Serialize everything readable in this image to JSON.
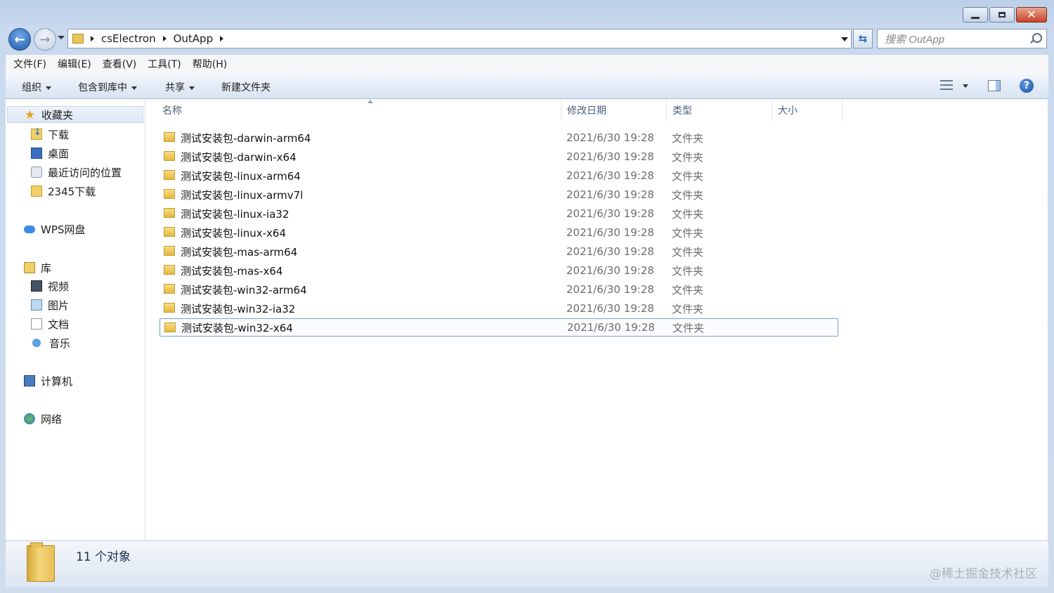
{
  "window": {
    "controls": {
      "minimize": "minimize-icon",
      "maximize": "maximize-icon",
      "close": "close-icon"
    }
  },
  "nav": {
    "breadcrumb": [
      "csElectron",
      "OutApp"
    ],
    "search_placeholder": "搜索 OutApp"
  },
  "menubar": [
    "文件(F)",
    "编辑(E)",
    "查看(V)",
    "工具(T)",
    "帮助(H)"
  ],
  "commands": {
    "organize": "组织",
    "include_library": "包含到库中",
    "share": "共享",
    "new_folder": "新建文件夹"
  },
  "sidebar": {
    "favorites": "收藏夹",
    "fav_items": [
      "下载",
      "桌面",
      "最近访问的位置",
      "2345下载"
    ],
    "wps": "WPS网盘",
    "library": "库",
    "lib_items": [
      "视频",
      "图片",
      "文档",
      "音乐"
    ],
    "computer": "计算机",
    "network": "网络"
  },
  "columns": {
    "name": "名称",
    "modified": "修改日期",
    "type": "类型",
    "size": "大小"
  },
  "files": [
    {
      "name": "测试安装包-darwin-arm64",
      "modified": "2021/6/30 19:28",
      "type": "文件夹"
    },
    {
      "name": "测试安装包-darwin-x64",
      "modified": "2021/6/30 19:28",
      "type": "文件夹"
    },
    {
      "name": "测试安装包-linux-arm64",
      "modified": "2021/6/30 19:28",
      "type": "文件夹"
    },
    {
      "name": "测试安装包-linux-armv7l",
      "modified": "2021/6/30 19:28",
      "type": "文件夹"
    },
    {
      "name": "测试安装包-linux-ia32",
      "modified": "2021/6/30 19:28",
      "type": "文件夹"
    },
    {
      "name": "测试安装包-linux-x64",
      "modified": "2021/6/30 19:28",
      "type": "文件夹"
    },
    {
      "name": "测试安装包-mas-arm64",
      "modified": "2021/6/30 19:28",
      "type": "文件夹"
    },
    {
      "name": "测试安装包-mas-x64",
      "modified": "2021/6/30 19:28",
      "type": "文件夹"
    },
    {
      "name": "测试安装包-win32-arm64",
      "modified": "2021/6/30 19:28",
      "type": "文件夹"
    },
    {
      "name": "测试安装包-win32-ia32",
      "modified": "2021/6/30 19:28",
      "type": "文件夹"
    },
    {
      "name": "测试安装包-win32-x64",
      "modified": "2021/6/30 19:28",
      "type": "文件夹",
      "selected": true
    }
  ],
  "details": {
    "count": "11 个对象"
  },
  "watermark": "@稀土掘金技术社区"
}
